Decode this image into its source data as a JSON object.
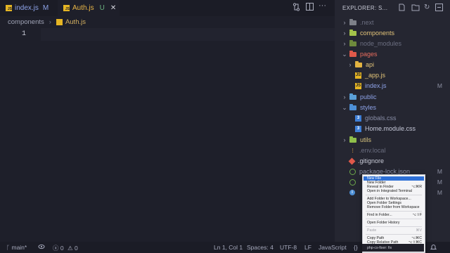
{
  "tabs": [
    {
      "label": "index.js",
      "badge": "M"
    },
    {
      "label": "Auth.js",
      "badge": "U",
      "close": "✕"
    }
  ],
  "breadcrumb": {
    "folder": "components",
    "file": "Auth.js"
  },
  "editor": {
    "line_number": "1"
  },
  "explorer": {
    "title": "EXPLORER: S...",
    "items": [
      {
        "label": ".next",
        "color": "#6b6e80"
      },
      {
        "label": "components",
        "color": "#e3c479"
      },
      {
        "label": "node_modules",
        "color": "#6b6e80"
      },
      {
        "label": "pages",
        "color": "#e96d5e"
      },
      {
        "label": "api",
        "color": "#e3c479"
      },
      {
        "label": "_app.js",
        "color": "#e3c479"
      },
      {
        "label": "index.js",
        "color": "#8ea3e8",
        "badge": "M"
      },
      {
        "label": "public",
        "color": "#8ea3e8"
      },
      {
        "label": "styles",
        "color": "#8ea3e8"
      },
      {
        "label": "globals.css",
        "color": "#8a8fa8"
      },
      {
        "label": "Home.module.css",
        "color": "#c5c8d8"
      },
      {
        "label": "utils",
        "color": "#d8c47e"
      },
      {
        "label": ".env.local",
        "color": "#6b6e80"
      },
      {
        "label": ".gitignore",
        "color": "#c8cad6"
      },
      {
        "label": "package-lock.json",
        "color": "#8a8fa8",
        "badge": "M"
      },
      {
        "label": "",
        "badge": "M"
      },
      {
        "label": "",
        "badge": "M"
      }
    ]
  },
  "context_menu": {
    "items": [
      {
        "label": "New File",
        "shortcut": ""
      },
      {
        "label": "New Folder",
        "shortcut": ""
      },
      {
        "label": "Reveal in Finder",
        "shortcut": "⌥⌘R"
      },
      {
        "label": "Open in Integrated Terminal",
        "shortcut": ""
      },
      {
        "label": "Add Folder to Workspace...",
        "shortcut": ""
      },
      {
        "label": "Open Folder Settings",
        "shortcut": ""
      },
      {
        "label": "Remove Folder from Workspace",
        "shortcut": ""
      },
      {
        "label": "Find in Folder...",
        "shortcut": "⌥⇧F"
      },
      {
        "label": "Open Folder History",
        "shortcut": ""
      },
      {
        "label": "Paste",
        "shortcut": "⌘V"
      },
      {
        "label": "Copy Path",
        "shortcut": "⌥⌘C"
      },
      {
        "label": "Copy Relative Path",
        "shortcut": "⌥⇧⌘C"
      },
      {
        "label": "php-cs-fixer: fix",
        "shortcut": ""
      }
    ]
  },
  "statusbar": {
    "branch": "main*",
    "errors": "0",
    "warnings": "0",
    "position": "Ln 1, Col 1",
    "spaces": "Spaces: 4",
    "encoding": "UTF-8",
    "eol": "LF",
    "language": "JavaScript"
  }
}
